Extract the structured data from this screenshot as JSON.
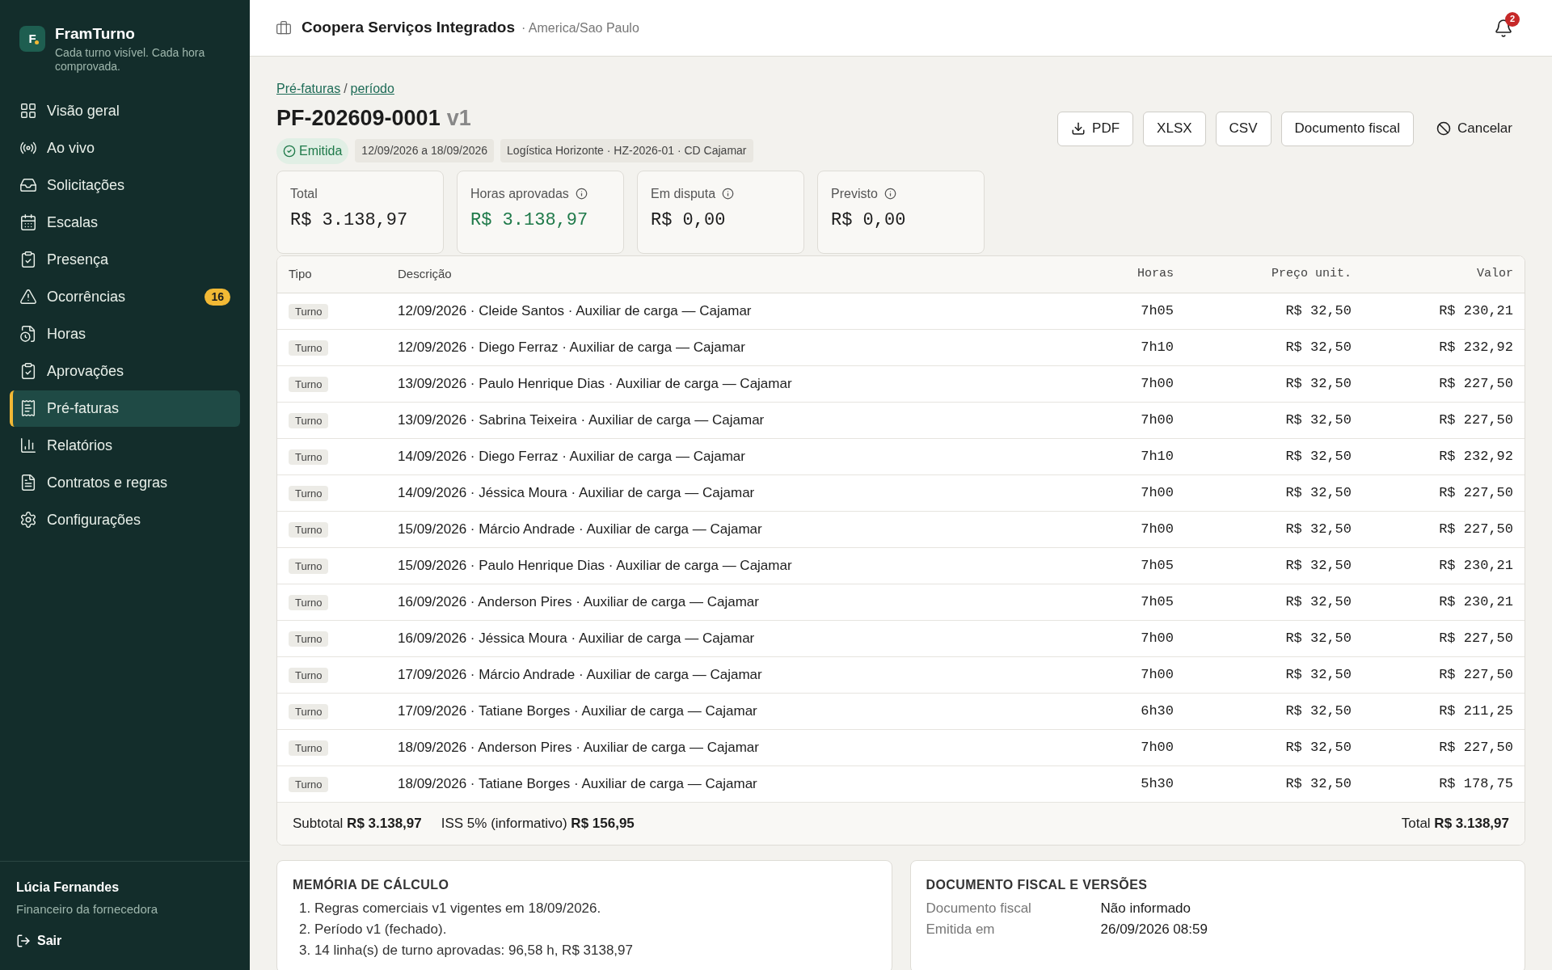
{
  "brand": {
    "name": "FramTurno",
    "tagline": "Cada turno visível. Cada hora comprovada.",
    "logo": "F"
  },
  "nav": [
    {
      "label": "Visão geral",
      "selected": false
    },
    {
      "label": "Ao vivo",
      "selected": false
    },
    {
      "label": "Solicitações",
      "selected": false
    },
    {
      "label": "Escalas",
      "selected": false
    },
    {
      "label": "Presença",
      "selected": false
    },
    {
      "label": "Ocorrências",
      "selected": false,
      "badge": "16"
    },
    {
      "label": "Horas",
      "selected": false
    },
    {
      "label": "Aprovações",
      "selected": false
    },
    {
      "label": "Pré-faturas",
      "selected": true
    },
    {
      "label": "Relatórios",
      "selected": false
    },
    {
      "label": "Contratos e regras",
      "selected": false
    },
    {
      "label": "Configurações",
      "selected": false
    }
  ],
  "user": {
    "name": "Lúcia Fernandes",
    "role": "Financeiro da fornecedora",
    "logout": "Sair"
  },
  "header": {
    "company": "Coopera Serviços Integrados",
    "timezone": "· America/Sao Paulo",
    "notifications": "2"
  },
  "breadcrumb": [
    "Pré-faturas",
    "/",
    "período"
  ],
  "title": {
    "code": "PF-202609-0001",
    "version": "v1"
  },
  "status": "Emitida",
  "chips": [
    "12/09/2026 a 18/09/2026",
    "Logística Horizonte · HZ-2026-01 · CD Cajamar"
  ],
  "actions": [
    {
      "label": "PDF",
      "kind": "download"
    },
    {
      "label": "XLSX",
      "kind": "outline"
    },
    {
      "label": "CSV",
      "kind": "outline"
    },
    {
      "label": "Documento fiscal",
      "kind": "outline"
    },
    {
      "label": "Cancelar",
      "kind": "ghost"
    }
  ],
  "stats": [
    {
      "label": "Total",
      "value": "R$ 3.138,97",
      "info": false,
      "positive": false
    },
    {
      "label": "Horas aprovadas",
      "value": "R$ 3.138,97",
      "info": true,
      "positive": true
    },
    {
      "label": "Em disputa",
      "value": "R$ 0,00",
      "info": true,
      "positive": false
    },
    {
      "label": "Previsto",
      "value": "R$ 0,00",
      "info": true,
      "positive": false
    }
  ],
  "table": {
    "columns": [
      "Tipo",
      "Descrição",
      "Horas",
      "Preço unit.",
      "Valor"
    ],
    "rows": [
      [
        "Turno",
        "12/09/2026 · Cleide Santos · Auxiliar de carga — Cajamar",
        "7h05",
        "R$ 32,50",
        "R$ 230,21"
      ],
      [
        "Turno",
        "12/09/2026 · Diego Ferraz · Auxiliar de carga — Cajamar",
        "7h10",
        "R$ 32,50",
        "R$ 232,92"
      ],
      [
        "Turno",
        "13/09/2026 · Paulo Henrique Dias · Auxiliar de carga — Cajamar",
        "7h00",
        "R$ 32,50",
        "R$ 227,50"
      ],
      [
        "Turno",
        "13/09/2026 · Sabrina Teixeira · Auxiliar de carga — Cajamar",
        "7h00",
        "R$ 32,50",
        "R$ 227,50"
      ],
      [
        "Turno",
        "14/09/2026 · Diego Ferraz · Auxiliar de carga — Cajamar",
        "7h10",
        "R$ 32,50",
        "R$ 232,92"
      ],
      [
        "Turno",
        "14/09/2026 · Jéssica Moura · Auxiliar de carga — Cajamar",
        "7h00",
        "R$ 32,50",
        "R$ 227,50"
      ],
      [
        "Turno",
        "15/09/2026 · Márcio Andrade · Auxiliar de carga — Cajamar",
        "7h00",
        "R$ 32,50",
        "R$ 227,50"
      ],
      [
        "Turno",
        "15/09/2026 · Paulo Henrique Dias · Auxiliar de carga — Cajamar",
        "7h05",
        "R$ 32,50",
        "R$ 230,21"
      ],
      [
        "Turno",
        "16/09/2026 · Anderson Pires · Auxiliar de carga — Cajamar",
        "7h05",
        "R$ 32,50",
        "R$ 230,21"
      ],
      [
        "Turno",
        "16/09/2026 · Jéssica Moura · Auxiliar de carga — Cajamar",
        "7h00",
        "R$ 32,50",
        "R$ 227,50"
      ],
      [
        "Turno",
        "17/09/2026 · Márcio Andrade · Auxiliar de carga — Cajamar",
        "7h00",
        "R$ 32,50",
        "R$ 227,50"
      ],
      [
        "Turno",
        "17/09/2026 · Tatiane Borges · Auxiliar de carga — Cajamar",
        "6h30",
        "R$ 32,50",
        "R$ 211,25"
      ],
      [
        "Turno",
        "18/09/2026 · Anderson Pires · Auxiliar de carga — Cajamar",
        "7h00",
        "R$ 32,50",
        "R$ 227,50"
      ],
      [
        "Turno",
        "18/09/2026 · Tatiane Borges · Auxiliar de carga — Cajamar",
        "5h30",
        "R$ 32,50",
        "R$ 178,75"
      ]
    ],
    "subtotal": "Subtotal **R$ 3.138,97**",
    "iss": "ISS 5% (informativo) **R$ 156,95**",
    "total": "Total **R$ 3.138,97**"
  },
  "memory": {
    "title": "MEMÓRIA DE CÁLCULO",
    "items": [
      "1. Regras comerciais v1 vigentes em 18/09/2026.",
      "2. Período v1 (fechado).",
      "3. 14 linha(s) de turno aprovadas: 96,58 h, R$ 3138,97"
    ]
  },
  "fiscal": {
    "title": "DOCUMENTO FISCAL E VERSÕES",
    "fields": [
      {
        "label": "Documento fiscal",
        "value": "Não informado"
      },
      {
        "label": "Emitida em",
        "value": "26/09/2026 08:59"
      }
    ]
  }
}
